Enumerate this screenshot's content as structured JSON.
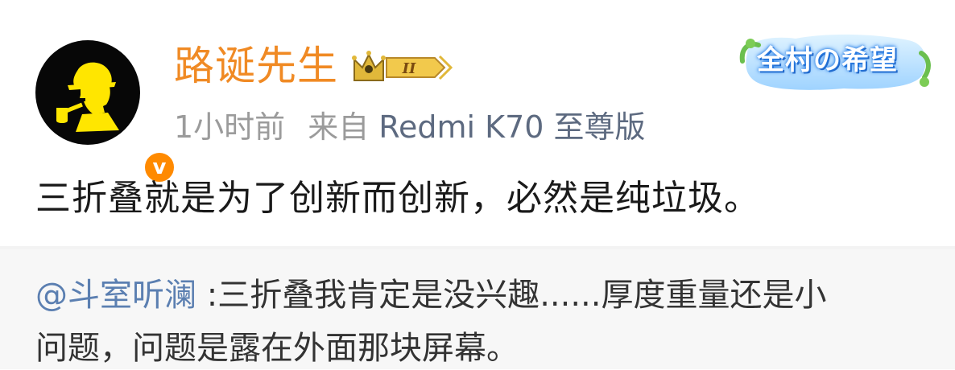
{
  "post": {
    "username": "路诞先生",
    "member_level": "II",
    "time": "1小时前",
    "source_prefix": "来自",
    "source_device": "Redmi K70 至尊版",
    "text": "三折叠就是为了创新而创新，必然是纯垃圾。",
    "banner_text": "全村の希望"
  },
  "repost": {
    "mention": "@斗室听澜",
    "line1_text": " :三折叠我肯定是没兴趣......厚度重量还是小",
    "line2_text": "问题，问题是露在外面那块屏幕。"
  },
  "colors": {
    "username": "#f08a24",
    "mention": "#5b7fb1",
    "meta": "#9b9b9b",
    "verified_badge": "#ff8a00",
    "repost_bg": "#f7f7f7"
  },
  "icons": {
    "avatar": "sherlock-silhouette-avatar",
    "verified": "verified-v-badge",
    "member": "crown-member-icon"
  }
}
